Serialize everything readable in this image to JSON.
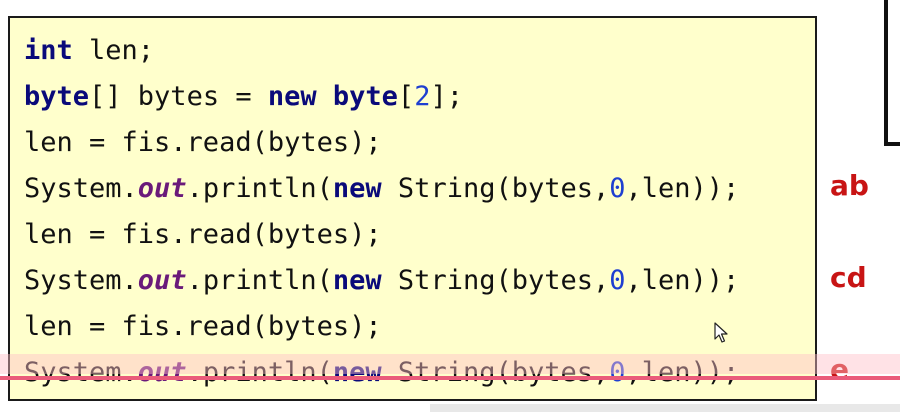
{
  "code": {
    "lines": [
      {
        "seg": [
          "int",
          " len;"
        ]
      },
      {
        "seg": [
          "byte",
          "[] bytes = ",
          "new",
          " ",
          "byte",
          "[",
          "2",
          "];"
        ]
      },
      {
        "seg": [
          "len = fis.read(bytes);"
        ]
      },
      {
        "seg": [
          "System.",
          "out",
          ".println(",
          "new",
          " String(bytes,",
          "0",
          ",len));"
        ]
      },
      {
        "seg": [
          "len = fis.read(bytes);"
        ]
      },
      {
        "seg": [
          "System.",
          "out",
          ".println(",
          "new",
          " String(bytes,",
          "0",
          ",len));"
        ]
      },
      {
        "seg": [
          "len = fis.read(bytes);"
        ]
      },
      {
        "seg": [
          "System.",
          "out",
          ".println(",
          "new",
          " String(bytes,",
          "0",
          ",len));"
        ]
      }
    ]
  },
  "outputs": [
    "ab",
    "cd",
    "e"
  ],
  "colors": {
    "code_background": "#ffffcc",
    "keyword": "#0a0a7a",
    "field": "#6a1a7a",
    "number": "#1f3fd0",
    "output_label": "#c81414",
    "highlight_line": "#ea5b7a"
  },
  "icons": {
    "cursor": "mouse-pointer-icon"
  }
}
